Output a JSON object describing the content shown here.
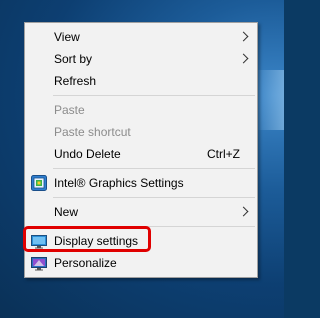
{
  "menu": {
    "items": [
      {
        "label": "View",
        "submenu": true
      },
      {
        "label": "Sort by",
        "submenu": true
      },
      {
        "label": "Refresh"
      },
      {
        "label": "Paste",
        "disabled": true
      },
      {
        "label": "Paste shortcut",
        "disabled": true
      },
      {
        "label": "Undo Delete",
        "shortcut": "Ctrl+Z"
      },
      {
        "label": "Intel® Graphics Settings",
        "icon": "intel-graphics-icon"
      },
      {
        "label": "New",
        "submenu": true
      },
      {
        "label": "Display settings",
        "icon": "display-settings-icon",
        "highlighted": true
      },
      {
        "label": "Personalize",
        "icon": "personalize-icon"
      }
    ]
  },
  "colors": {
    "menu_bg": "#f2f2f2",
    "disabled_text": "#8c8c8c",
    "highlight_border": "#e00000",
    "desktop_bg": "#0b3a63"
  }
}
